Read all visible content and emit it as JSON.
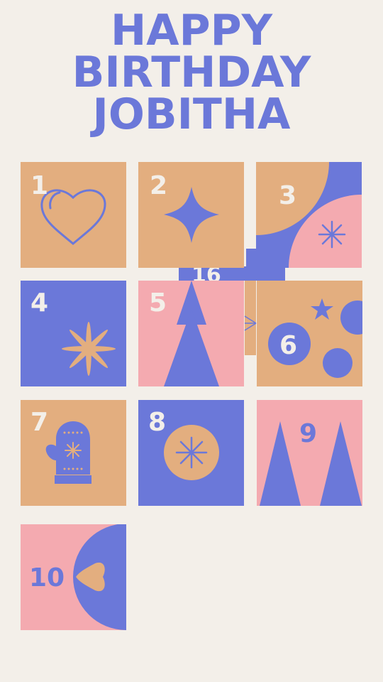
{
  "title": {
    "line1": "HAPPY",
    "line2": "BIRTHDAY",
    "line3": "JOBITHA"
  },
  "hidden_tile_number": "16",
  "tiles": [
    {
      "number": "1",
      "icon": "heart-outline-icon"
    },
    {
      "number": "2",
      "icon": "sparkle-star-icon"
    },
    {
      "number": "3",
      "icon": "snowflake-icon"
    },
    {
      "number": "4",
      "icon": "flower-burst-icon"
    },
    {
      "number": "5",
      "icon": "christmas-tree-icon"
    },
    {
      "number": "6",
      "icon": "ornament-dots-icon"
    },
    {
      "number": "7",
      "icon": "mitten-icon"
    },
    {
      "number": "8",
      "icon": "snowflake-circle-icon"
    },
    {
      "number": "9",
      "icon": "twin-trees-icon"
    },
    {
      "number": "10",
      "icon": "heart-icon"
    }
  ],
  "colors": {
    "background": "#f3efe9",
    "blue": "#6b78d9",
    "tan": "#e3ae7f",
    "pink": "#f4aab0",
    "cream": "#f3efe9"
  }
}
